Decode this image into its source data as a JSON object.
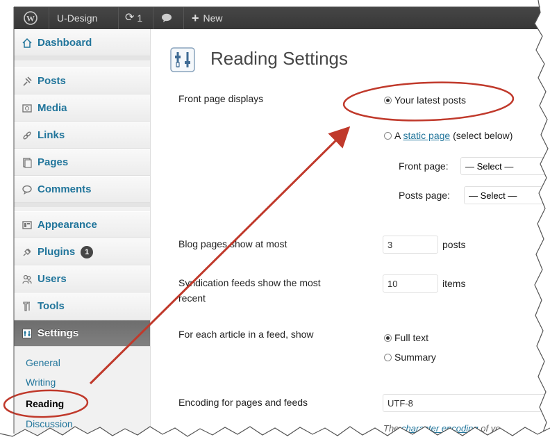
{
  "adminbar": {
    "site_name": "U-Design",
    "updates_count": "1",
    "new_label": "New"
  },
  "sidebar": {
    "items": [
      {
        "label": "Dashboard",
        "icon": "home-icon"
      },
      {
        "label": "Posts",
        "icon": "pin-icon"
      },
      {
        "label": "Media",
        "icon": "media-icon"
      },
      {
        "label": "Links",
        "icon": "link-icon"
      },
      {
        "label": "Pages",
        "icon": "pages-icon"
      },
      {
        "label": "Comments",
        "icon": "comment-icon"
      },
      {
        "label": "Appearance",
        "icon": "appearance-icon"
      },
      {
        "label": "Plugins",
        "icon": "plugin-icon",
        "badge": "1"
      },
      {
        "label": "Users",
        "icon": "users-icon"
      },
      {
        "label": "Tools",
        "icon": "tools-icon"
      },
      {
        "label": "Settings",
        "icon": "settings-icon"
      }
    ],
    "submenu": [
      "General",
      "Writing",
      "Reading",
      "Discussion"
    ]
  },
  "main": {
    "title": "Reading Settings",
    "front_page_displays_label": "Front page displays",
    "option_latest_posts": "Your latest posts",
    "option_static_prefix": "A",
    "option_static_link": "static page",
    "option_static_suffix": "(select below)",
    "front_page_label": "Front page:",
    "front_page_select": "— Select —",
    "posts_page_label": "Posts page:",
    "posts_page_select": "— Select —",
    "blog_pages_label": "Blog pages show at most",
    "blog_pages_value": "3",
    "blog_pages_unit": "posts",
    "syndication_label_1": "Syndication feeds show the most",
    "syndication_label_2": "recent",
    "syndication_value": "10",
    "syndication_unit": "items",
    "feed_article_label": "For each article in a feed, show",
    "feed_full_text": "Full text",
    "feed_summary": "Summary",
    "encoding_label": "Encoding for pages and feeds",
    "encoding_value": "UTF-8",
    "encoding_help_prefix": "The",
    "encoding_help_link": "character encoding",
    "encoding_help_suffix": "of yo"
  },
  "colors": {
    "annotation": "#c0392b",
    "link": "#21759b",
    "adminbar": "#464646"
  }
}
